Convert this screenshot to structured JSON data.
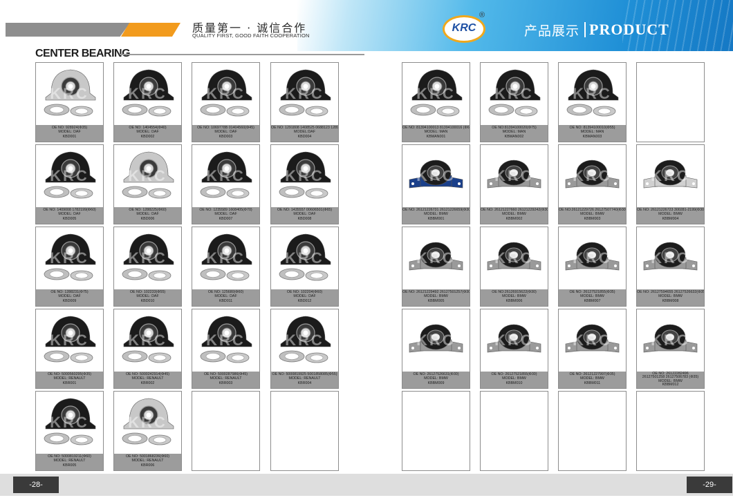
{
  "header": {
    "slogan_cn": "质量第一 · 诚信合作",
    "slogan_en": "QUALITY FIRST, GOOD FAITH COOPERATION",
    "logo": "KRC",
    "logo_mark": "®",
    "product_cn": "产品展示",
    "product_en": "PRODUCT"
  },
  "section_title": "CENTER BEARING",
  "footer": {
    "page_left": "-28-",
    "page_right": "-29-"
  },
  "colors": {
    "accent_orange": "#f29b1d",
    "header_blue": "#1f8fd6",
    "info_grey": "#9c9c9c"
  },
  "products": [
    {
      "oe": "OE NO: 928924(Φ35)",
      "model": "MODEL: DAF",
      "code": "KBD001"
    },
    {
      "oe": "OE NO: 1404554(Φ40)",
      "model": "MODEL: DAF",
      "code": "KBD002"
    },
    {
      "oe": "OE NO: 1069778B 01404560(Φ45)",
      "model": "MODEL: DAF",
      "code": "KBD003"
    },
    {
      "oe": "OE NO: 1291808 1408525 0688123 1289157(Φ65)",
      "model": "MODEL:DAF",
      "code": "KBD004"
    },
    {
      "oe": "OE NO: 1409008 1782199(Φ60)",
      "model": "MODEL: DAF",
      "code": "KBD005"
    },
    {
      "oe": "OE NO: 1288225(Φ60)",
      "model": "MODEL: DAF",
      "code": "KBD006"
    },
    {
      "oe": "OE NO: 1235589 1608405(Φ70)",
      "model": "MODEL: DAF",
      "code": "KBD007"
    },
    {
      "oe": "OE NO: 1435557 00606501(Φ65)",
      "model": "MODEL: DAF",
      "code": "KBD008"
    },
    {
      "oe": "OE NO: 1288231(Φ75)",
      "model": "MODEL: DAF",
      "code": "KBD009"
    },
    {
      "oe": "OE NO: 102233(Φ55)",
      "model": "MODEL: DAF",
      "code": "KBD010"
    },
    {
      "oe": "OE NO: 125680(Φ60)",
      "model": "MODEL: DAF",
      "code": "KBD011"
    },
    {
      "oe": "OE NO: 102204(Φ60)",
      "model": "MODEL: DAF",
      "code": "KBD012"
    },
    {
      "oe": "OE NO: 5000560295(Φ35)",
      "model": "MODEL: RENAULT",
      "code": "KBR001"
    },
    {
      "oe": "OE NO: 5000242914(Φ45)",
      "model": "MODEL: RENAULT",
      "code": "KBR002"
    },
    {
      "oe": "OE NO: 5000287986(Φ45)",
      "model": "MODEL: RENAULT",
      "code": "KBR003"
    },
    {
      "oe": "OE NO: 5000819925 5001858085(Φ55)",
      "model": "MODEL: RENAULT",
      "code": "KBR004"
    },
    {
      "oe": "OE NO: 5000819211(Φ60)",
      "model": "MODEL: RENAULT",
      "code": "KBR005"
    },
    {
      "oe": "OE NO: 5001868236(Φ60)",
      "model": "MODEL: RENAULT",
      "code": "KBR006"
    },
    {
      "oe": "OE NO: 81394100013 81394100016 (Φ65)",
      "model": "MODEL: MAN",
      "code": "KBMAN001"
    },
    {
      "oe": "OE NO:81394100020(Φ75)",
      "model": "MODEL: MAN",
      "code": "KBMAN002"
    },
    {
      "oe": "OE NO: 81394100010(Φ55)",
      "model": "MODEL: MAN",
      "code": "KBMAN003"
    },
    {
      "oe": "OE NO: 26121226731 26121226659(Φ30)",
      "model": "MODEL: BMW",
      "code": "KBBM001"
    },
    {
      "oe": "OE NO: 26121227660 26121229242(Φ30)",
      "model": "MODEL: BMW",
      "code": "KBBM002"
    },
    {
      "oe": "OE NO:26121229726 26127507740(Φ30)",
      "model": "MODEL: BMW",
      "code": "KBBM003"
    },
    {
      "oe": "OE NO: 26121226723 300281-2199(Φ30)",
      "model": "MODEL: BMW",
      "code": "KBBM004"
    },
    {
      "oe": "OE NO: 26121229492 26127501257(Φ30)",
      "model": "MODEL: BMW",
      "code": "KBBM005"
    },
    {
      "oe": "OE NO:26126915622(Φ30)",
      "model": "MODEL: BMW",
      "code": "KBBM006"
    },
    {
      "oe": "OE NO: 26127521855(Φ35)",
      "model": "MODEL: BMW",
      "code": "KBBM007"
    },
    {
      "oe": "OE NO: 26127594655 26127526632(Φ35)",
      "model": "MODEL: BMW",
      "code": "KBBM008"
    },
    {
      "oe": "OE NO: 26127526631(Φ30)",
      "model": "MODEL: BMW",
      "code": "KBBM009"
    },
    {
      "oe": "OE NO: 26127521855(Φ30)",
      "model": "MODEL: BMW",
      "code": "KBBM010"
    },
    {
      "oe": "OE NO: 26121227997(Φ35)",
      "model": "MODEL: BMW",
      "code": "KBBM011"
    },
    {
      "oe": "OE NO: 26122282496",
      "oe2": "26127501258 26127506783 (Φ35)",
      "model": "MODEL: BMW",
      "code": "KBBM012"
    }
  ]
}
